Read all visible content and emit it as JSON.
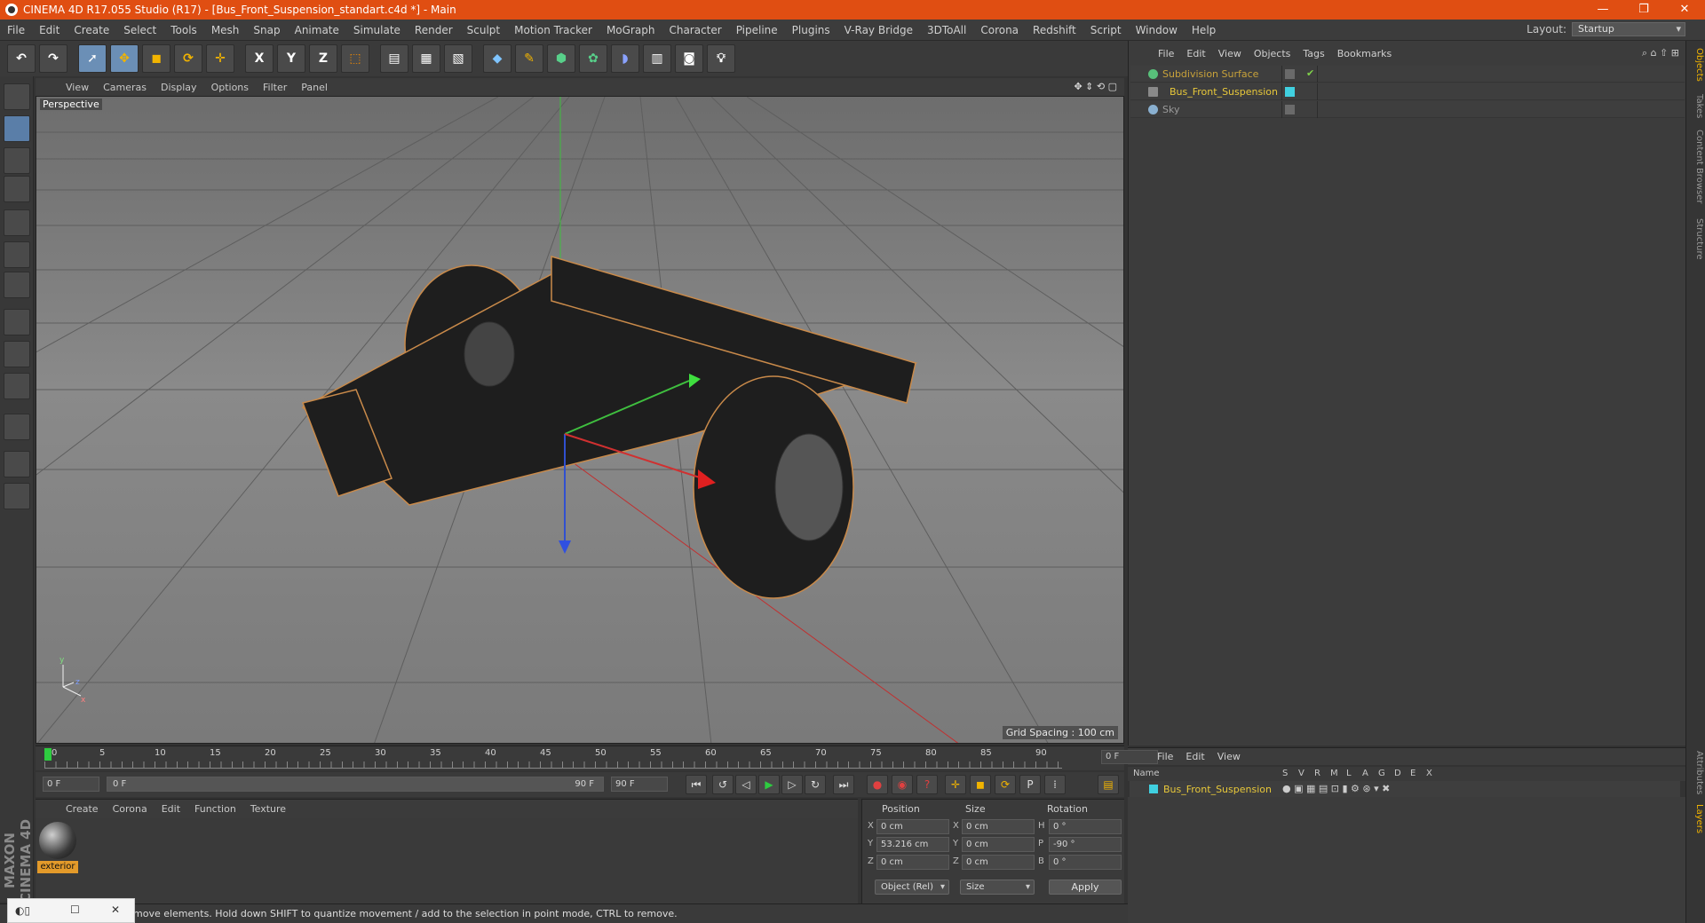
{
  "window": {
    "title": "CINEMA 4D R17.055 Studio (R17) - [Bus_Front_Suspension_standart.c4d *] - Main",
    "minimize": "—",
    "restore": "❐",
    "close": "✕"
  },
  "menu": [
    "File",
    "Edit",
    "Create",
    "Select",
    "Tools",
    "Mesh",
    "Snap",
    "Animate",
    "Simulate",
    "Render",
    "Sculpt",
    "Motion Tracker",
    "MoGraph",
    "Character",
    "Pipeline",
    "Plugins",
    "V-Ray Bridge",
    "3DToAll",
    "Corona",
    "Redshift",
    "Script",
    "Window",
    "Help"
  ],
  "layout": {
    "label": "Layout:",
    "value": "Startup"
  },
  "toolbar": {
    "axis_x": "X",
    "axis_y": "Y",
    "axis_z": "Z"
  },
  "viewport": {
    "menu": [
      "View",
      "Cameras",
      "Display",
      "Options",
      "Filter",
      "Panel"
    ],
    "label": "Perspective",
    "grid_spacing": "Grid Spacing : 100 cm",
    "axis_y": "y",
    "axis_z": "z",
    "axis_x": "x"
  },
  "objects": {
    "menu": [
      "File",
      "Edit",
      "View",
      "Objects",
      "Tags",
      "Bookmarks"
    ],
    "items": [
      {
        "name": "Subdivision Surface",
        "color": "#c8a23a"
      },
      {
        "name": "Bus_Front_Suspension",
        "color": "#e8c83a"
      },
      {
        "name": "Sky",
        "color": "#9a9a9a"
      }
    ]
  },
  "side_tabs": [
    "Objects",
    "Takes",
    "Content Browser",
    "Structure",
    "Attributes",
    "Layers"
  ],
  "timeline": {
    "ticks": [
      "0",
      "5",
      "10",
      "15",
      "20",
      "25",
      "30",
      "35",
      "40",
      "45",
      "50",
      "55",
      "60",
      "65",
      "70",
      "75",
      "80",
      "85",
      "90"
    ],
    "frame": "0 F"
  },
  "transport": {
    "start": "0 F",
    "range_start": "0 F",
    "range_end": "90 F",
    "end": "90 F"
  },
  "layers": {
    "menu": [
      "File",
      "Edit",
      "View"
    ],
    "name_header": "Name",
    "flags": [
      "S",
      "V",
      "R",
      "M",
      "L",
      "A",
      "G",
      "D",
      "E",
      "X"
    ],
    "row_name": "Bus_Front_Suspension"
  },
  "materials": {
    "menu": [
      "Create",
      "Corona",
      "Edit",
      "Function",
      "Texture"
    ],
    "name": "exterior"
  },
  "coords": {
    "position_header": "Position",
    "size_header": "Size",
    "rotation_header": "Rotation",
    "px": "0 cm",
    "py": "53.216 cm",
    "pz": "0 cm",
    "sx": "0 cm",
    "sy": "0 cm",
    "sz": "0 cm",
    "rh": "0 °",
    "rp": "-90 °",
    "rb": "0 °",
    "label_x": "X",
    "label_y": "Y",
    "label_z": "Z",
    "label_h": "H",
    "label_p": "P",
    "label_b": "B",
    "mode": "Object (Rel)",
    "size_mode": "Size",
    "apply": "Apply"
  },
  "status": "move elements. Hold down SHIFT to quantize movement / add to the selection in point mode, CTRL to remove.",
  "brand": "MAXON CINEMA 4D"
}
